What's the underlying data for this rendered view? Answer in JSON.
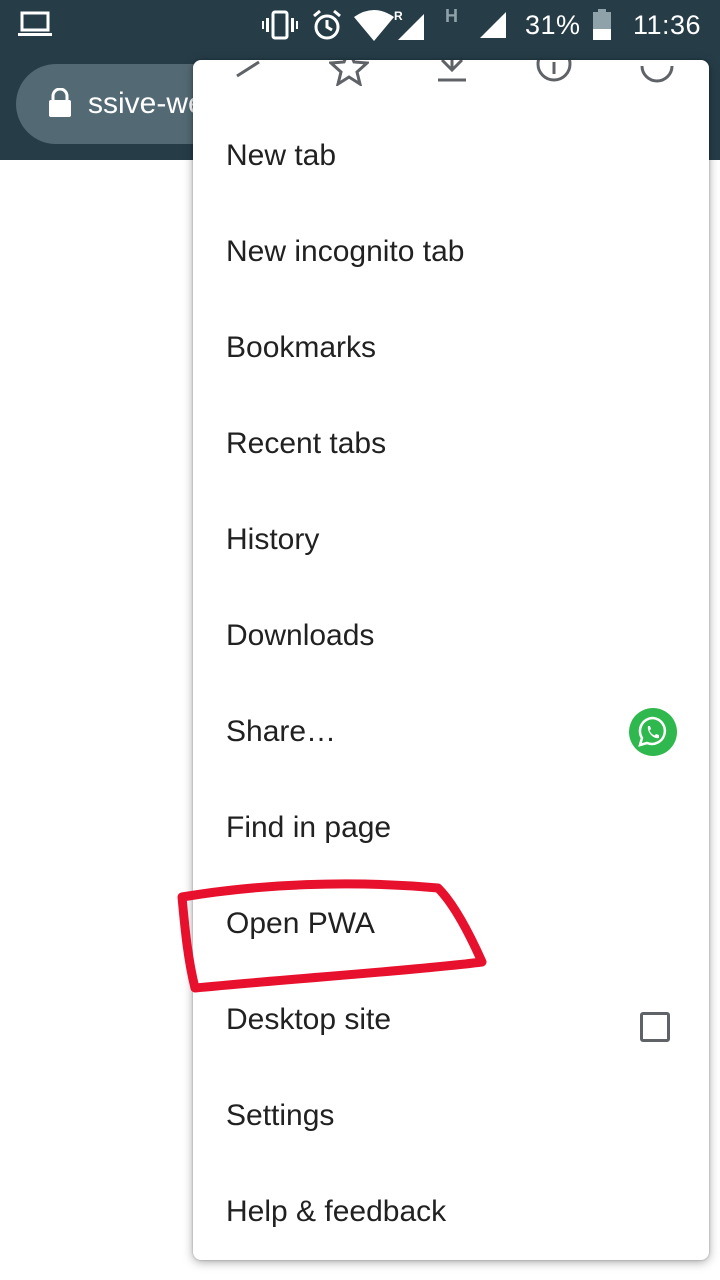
{
  "status_bar": {
    "battery_percent": "31%",
    "time": "11:36",
    "network_letter": "H",
    "roaming_letter": "R",
    "icons": [
      "laptop-icon",
      "vibrate-icon",
      "alarm-icon",
      "wifi-icon",
      "signal-icon",
      "battery-icon"
    ]
  },
  "toolbar": {
    "url_fragment": "ssive-we",
    "lock_icon": "lock-icon"
  },
  "menu": {
    "icon_row": [
      "forward-icon",
      "bookmark-star-icon",
      "download-icon",
      "info-icon",
      "refresh-icon"
    ],
    "items": [
      {
        "label": "New tab"
      },
      {
        "label": "New incognito tab"
      },
      {
        "label": "Bookmarks"
      },
      {
        "label": "Recent tabs"
      },
      {
        "label": "History"
      },
      {
        "label": "Downloads"
      },
      {
        "label": "Share…",
        "trailing_icon": "whatsapp-icon"
      },
      {
        "label": "Find in page"
      },
      {
        "label": "Open PWA",
        "highlighted": true
      },
      {
        "label": "Desktop site",
        "checkbox_checked": false
      },
      {
        "label": "Settings"
      },
      {
        "label": "Help & feedback"
      }
    ]
  },
  "colors": {
    "header_bg": "#263d48",
    "omnibox_bg": "#536a74",
    "highlight_annotation": "#e8112d",
    "whatsapp_green": "#2fb84d"
  }
}
